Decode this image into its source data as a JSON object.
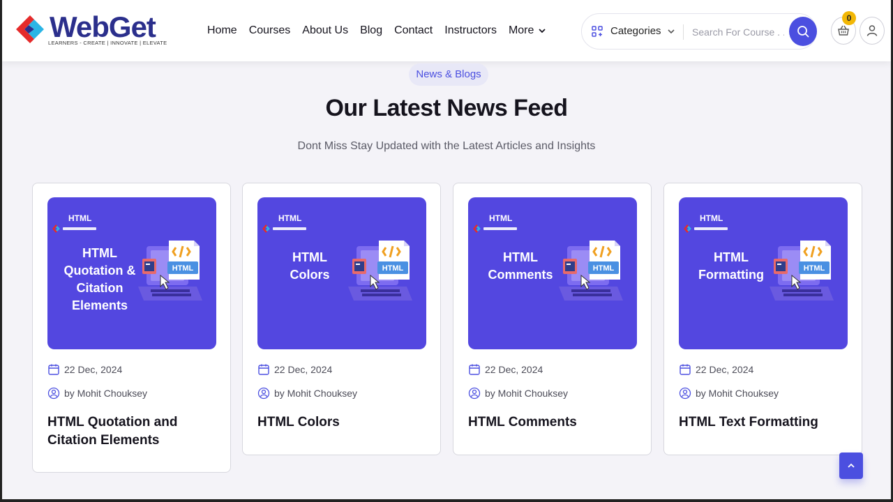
{
  "brand": {
    "name": "WebGet",
    "tagline": "LEARNERS - CREATE | INNOVATE | ELEVATE"
  },
  "nav": {
    "items": [
      "Home",
      "Courses",
      "About Us",
      "Blog",
      "Contact",
      "Instructors",
      "More"
    ]
  },
  "search": {
    "categories_label": "Categories",
    "placeholder": "Search For Course . . ."
  },
  "cart": {
    "count": "0"
  },
  "section": {
    "pill": "News & Blogs",
    "title": "Our Latest News Feed",
    "subtitle": "Dont Miss Stay Updated with the Latest Articles and Insights"
  },
  "cards": [
    {
      "thumb_tag": "HTML",
      "thumb_title_lines": [
        "HTML",
        "Quotation &",
        "Citation",
        "Elements"
      ],
      "date": "22 Dec, 2024",
      "author": "by Mohit Chouksey",
      "title": "HTML Quotation and Citation Elements"
    },
    {
      "thumb_tag": "HTML",
      "thumb_title_lines": [
        "HTML",
        "Colors"
      ],
      "date": "22 Dec, 2024",
      "author": "by Mohit Chouksey",
      "title": "HTML Colors"
    },
    {
      "thumb_tag": "HTML",
      "thumb_title_lines": [
        "HTML",
        "Comments"
      ],
      "date": "22 Dec, 2024",
      "author": "by Mohit Chouksey",
      "title": "HTML Comments"
    },
    {
      "thumb_tag": "HTML",
      "thumb_title_lines": [
        "HTML",
        "Formatting"
      ],
      "date": "22 Dec, 2024",
      "author": "by Mohit Chouksey",
      "title": "HTML Text Formatting"
    }
  ],
  "art_label": "HTML",
  "colors": {
    "accent": "#4b4fe0",
    "thumb_bg": "#5347e0",
    "badge": "#f2b705",
    "logo_red": "#e52b2b",
    "logo_blue": "#2b2f8c"
  }
}
